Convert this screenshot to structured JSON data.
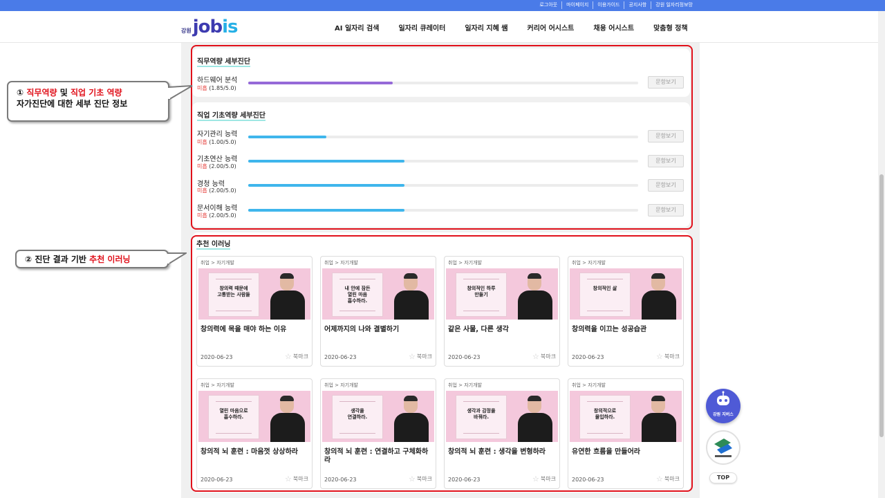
{
  "top_links": [
    "로그아웃",
    "마이페이지",
    "이용가이드",
    "공지사항",
    "강원 일자리정보망"
  ],
  "logo": {
    "region": "강원",
    "brand_a": "job",
    "brand_b": "is"
  },
  "nav": [
    "AI 일자리 검색",
    "일자리 큐레이터",
    "일자리 지혜 쌤",
    "커리어 어시스트",
    "채용 어시스트",
    "맞춤형 정책"
  ],
  "job_competency": {
    "title": "직무역량 세부진단",
    "items": [
      {
        "name": "하드웨어 분석",
        "level": "미흡",
        "score": "(1.85/5.0)",
        "value": 1.85,
        "button": "문항보기"
      }
    ]
  },
  "basic_competency": {
    "title": "직업 기초역량 세부진단",
    "items": [
      {
        "name": "자기관리 능력",
        "level": "미흡",
        "score": "(1.00/5.0)",
        "value": 1.0,
        "button": "문항보기"
      },
      {
        "name": "기초연산 능력",
        "level": "미흡",
        "score": "(2.00/5.0)",
        "value": 2.0,
        "button": "문항보기"
      },
      {
        "name": "경청 능력",
        "level": "미흡",
        "score": "(2.00/5.0)",
        "value": 2.0,
        "button": "문항보기"
      },
      {
        "name": "문서이해 능력",
        "level": "미흡",
        "score": "(2.00/5.0)",
        "value": 2.0,
        "button": "문항보기"
      }
    ]
  },
  "callout1": {
    "num": "①",
    "p1": "직무역량",
    "p2": "및",
    "p3": "직업 기초 역량",
    "line2": "자가진단에 대한 세부 진단 정보"
  },
  "callout2": {
    "num": "②",
    "p1": "진단 결과 기반",
    "p2": "추천 이러닝"
  },
  "elearning": {
    "title": "추천 이러닝",
    "cards": [
      {
        "category": "취업 > 자기개발",
        "poster": "창의력 때문에\n고통받는 사람들",
        "title": "창의력에 목을 매야 하는 이유",
        "date": "2020-06-23",
        "bookmark": "북마크"
      },
      {
        "category": "취업 > 자기개발",
        "poster": "내 안에 잠든\n열린 마음\n흡수하라.",
        "title": "어제까지의 나와 결별하기",
        "date": "2020-06-23",
        "bookmark": "북마크"
      },
      {
        "category": "취업 > 자기개발",
        "poster": "창의적인 하루\n만들기",
        "title": "같은 사물, 다른 생각",
        "date": "2020-06-23",
        "bookmark": "북마크"
      },
      {
        "category": "취업 > 자기개발",
        "poster": "창의적인 삶",
        "title": "창의력을 이끄는 성공습관",
        "date": "2020-06-23",
        "bookmark": "북마크"
      },
      {
        "category": "취업 > 자기개발",
        "poster": "열린 마음으로\n흡수하라.",
        "title": "창의적 뇌 훈련 : 마음껏 상상하라",
        "date": "2020-06-23",
        "bookmark": "북마크"
      },
      {
        "category": "취업 > 자기개발",
        "poster": "생각을\n연결하라.",
        "title": "창의적 뇌 훈련 : 연결하고 구체화하라",
        "date": "2020-06-23",
        "bookmark": "북마크"
      },
      {
        "category": "취업 > 자기개발",
        "poster": "생각과 감정을\n바꿔라.",
        "title": "창의적 뇌 훈련 : 생각을 변형하라",
        "date": "2020-06-23",
        "bookmark": "북마크"
      },
      {
        "category": "취업 > 자기개발",
        "poster": "창의적으로\n몰입하라.",
        "title": "유연한 흐름을 만들어라",
        "date": "2020-06-23",
        "bookmark": "북마크"
      }
    ]
  },
  "floating": {
    "assist_label": "강원 지버스",
    "top_label": "TOP"
  },
  "colors": {
    "topbar": "#4a7be8",
    "job_bar": "#9569d8",
    "basic_bar": "#3fb6ec",
    "level_red": "#e53935",
    "highlight_red": "#e0101a"
  }
}
